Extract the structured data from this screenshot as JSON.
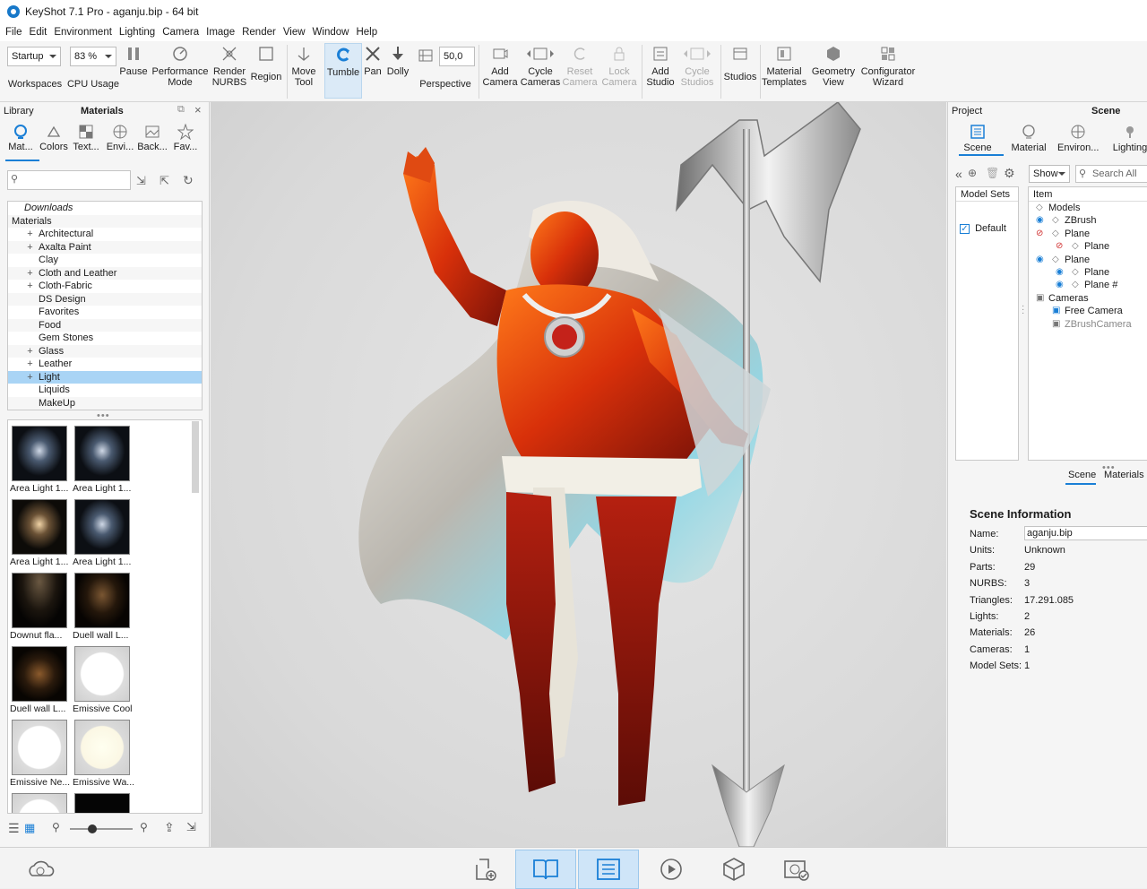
{
  "window": {
    "title": "KeyShot 7.1 Pro  -  aganju.bip  - 64 bit"
  },
  "menu": [
    "File",
    "Edit",
    "Environment",
    "Lighting",
    "Camera",
    "Image",
    "Render",
    "View",
    "Window",
    "Help"
  ],
  "toolbar": {
    "workspace_value": "Startup",
    "workspaces_label": "Workspaces",
    "cpu_value": "83 %",
    "cpu_label": "CPU Usage",
    "pause_label": "Pause",
    "performance_label_1": "Performance",
    "performance_label_2": "Mode",
    "render_label_1": "Render",
    "render_label_2": "NURBS",
    "region_label": "Region",
    "move_label_1": "Move",
    "move_label_2": "Tool",
    "tumble_label": "Tumble",
    "pan_label": "Pan",
    "dolly_label": "Dolly",
    "perspective_value": "50,0",
    "perspective_label": "Perspective",
    "add_camera_1": "Add",
    "add_camera_2": "Camera",
    "cycle_cameras_1": "Cycle",
    "cycle_cameras_2": "Cameras",
    "reset_camera_1": "Reset",
    "reset_camera_2": "Camera",
    "lock_camera_1": "Lock",
    "lock_camera_2": "Camera",
    "add_studio_1": "Add",
    "add_studio_2": "Studio",
    "cycle_studios_1": "Cycle",
    "cycle_studios_2": "Studios",
    "studios_label": "Studios",
    "material_templates_1": "Material",
    "material_templates_2": "Templates",
    "geometry_view_1": "Geometry",
    "geometry_view_2": "View",
    "configurator_1": "Configurator",
    "configurator_2": "Wizard"
  },
  "library": {
    "header_left": "Library",
    "header_title": "Materials",
    "tabs": [
      "Mat...",
      "Colors",
      "Text...",
      "Envi...",
      "Back...",
      "Fav..."
    ],
    "tree": [
      {
        "label": "Downloads",
        "level": 1,
        "expander": "",
        "italic": true
      },
      {
        "label": "Materials",
        "level": 0,
        "expander": "−"
      },
      {
        "label": "Architectural",
        "level": 2,
        "expander": "+"
      },
      {
        "label": "Axalta Paint",
        "level": 2,
        "expander": "+"
      },
      {
        "label": "Clay",
        "level": 2,
        "expander": ""
      },
      {
        "label": "Cloth and Leather",
        "level": 2,
        "expander": "+"
      },
      {
        "label": "Cloth-Fabric",
        "level": 2,
        "expander": "+"
      },
      {
        "label": "DS Design",
        "level": 2,
        "expander": ""
      },
      {
        "label": "Favorites",
        "level": 2,
        "expander": ""
      },
      {
        "label": "Food",
        "level": 2,
        "expander": ""
      },
      {
        "label": "Gem Stones",
        "level": 2,
        "expander": ""
      },
      {
        "label": "Glass",
        "level": 2,
        "expander": "+"
      },
      {
        "label": "Leather",
        "level": 2,
        "expander": "+"
      },
      {
        "label": "Light",
        "level": 2,
        "expander": "+",
        "selected": true
      },
      {
        "label": "Liquids",
        "level": 2,
        "expander": ""
      },
      {
        "label": "MakeUp",
        "level": 2,
        "expander": ""
      }
    ],
    "thumbnails": [
      {
        "label": "Area Light 1...",
        "style": "area"
      },
      {
        "label": "Area Light 1...",
        "style": "area"
      },
      {
        "label": "Area Light 1...",
        "style": "areawarm"
      },
      {
        "label": "Area Light 1...",
        "style": "area"
      },
      {
        "label": "Downut fla...",
        "style": "down"
      },
      {
        "label": "Duell wall L...",
        "style": "duell"
      },
      {
        "label": "Duell wall L...",
        "style": "duell2"
      },
      {
        "label": "Emissive Cool",
        "style": "white"
      },
      {
        "label": "Emissive Ne...",
        "style": "white"
      },
      {
        "label": "Emissive Wa...",
        "style": "warm"
      },
      {
        "label": "",
        "style": "white"
      },
      {
        "label": "",
        "style": "black"
      }
    ]
  },
  "project": {
    "header_left": "Project",
    "header_title": "Scene",
    "tabs": [
      "Scene",
      "Material",
      "Environ...",
      "Lighting"
    ],
    "show_label": "Show",
    "search_placeholder": "Search All",
    "model_sets_header": "Model Sets",
    "default_set": "Default",
    "item_header": "Item",
    "scene_tree": [
      {
        "label": "Models",
        "level": 0
      },
      {
        "label": "ZBrush",
        "level": 1
      },
      {
        "label": "Plane",
        "level": 1
      },
      {
        "label": "Plane",
        "level": 2
      },
      {
        "label": "Plane",
        "level": 1
      },
      {
        "label": "Plane",
        "level": 2
      },
      {
        "label": "Plane #",
        "level": 2
      },
      {
        "label": "Cameras",
        "level": 0
      },
      {
        "label": "Free Camera",
        "level": 1
      },
      {
        "label": "ZBrushCamera",
        "level": 1
      }
    ],
    "subtabs": [
      "Scene",
      "Materials"
    ],
    "info_title": "Scene Information",
    "info": [
      {
        "key": "Name:",
        "value": "aganju.bip"
      },
      {
        "key": "Units:",
        "value": "Unknown"
      },
      {
        "key": "Parts:",
        "value": "29"
      },
      {
        "key": "NURBS:",
        "value": "3"
      },
      {
        "key": "Triangles:",
        "value": "17.291.085"
      },
      {
        "key": "Lights:",
        "value": "2"
      },
      {
        "key": "Materials:",
        "value": "26"
      },
      {
        "key": "Cameras:",
        "value": "1"
      },
      {
        "key": "Model Sets:",
        "value": "1"
      }
    ]
  }
}
